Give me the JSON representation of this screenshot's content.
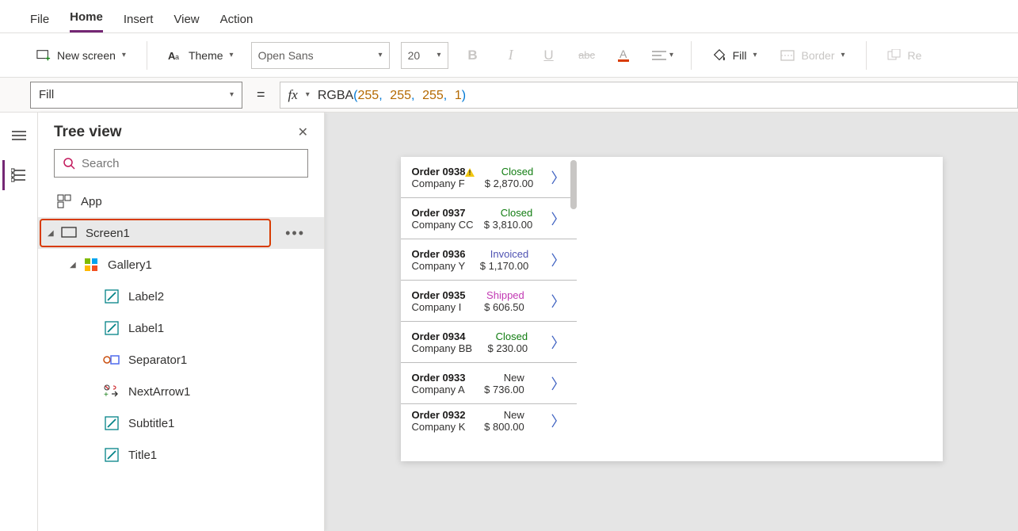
{
  "menubar": [
    "File",
    "Home",
    "Insert",
    "View",
    "Action"
  ],
  "active_tab": "Home",
  "ribbon": {
    "new_screen": "New screen",
    "theme": "Theme",
    "font_name": "Open Sans",
    "font_size": "20",
    "fill_label": "Fill",
    "border_label": "Border",
    "reorder_label": "Re"
  },
  "formula": {
    "property": "Fill",
    "fx": "fx",
    "expr_fn": "RGBA",
    "expr_args": [
      "255",
      "255",
      "255",
      "1"
    ]
  },
  "tree": {
    "title": "Tree view",
    "search_placeholder": "Search",
    "nodes": {
      "app": "App",
      "screen1": "Screen1",
      "gallery1": "Gallery1",
      "label2": "Label2",
      "label1": "Label1",
      "separator1": "Separator1",
      "nextarrow1": "NextArrow1",
      "subtitle1": "Subtitle1",
      "title1": "Title1"
    }
  },
  "gallery": [
    {
      "order": "Order 0938",
      "company": "Company F",
      "status": "Closed",
      "status_class": "st-closed",
      "amount": "$ 2,870.00",
      "warn": true
    },
    {
      "order": "Order 0937",
      "company": "Company CC",
      "status": "Closed",
      "status_class": "st-closed",
      "amount": "$ 3,810.00",
      "warn": false
    },
    {
      "order": "Order 0936",
      "company": "Company Y",
      "status": "Invoiced",
      "status_class": "st-invoiced",
      "amount": "$ 1,170.00",
      "warn": false
    },
    {
      "order": "Order 0935",
      "company": "Company I",
      "status": "Shipped",
      "status_class": "st-shipped",
      "amount": "$ 606.50",
      "warn": false
    },
    {
      "order": "Order 0934",
      "company": "Company BB",
      "status": "Closed",
      "status_class": "st-closed",
      "amount": "$ 230.00",
      "warn": false
    },
    {
      "order": "Order 0933",
      "company": "Company A",
      "status": "New",
      "status_class": "st-new",
      "amount": "$ 736.00",
      "warn": false
    },
    {
      "order": "Order 0932",
      "company": "Company K",
      "status": "New",
      "status_class": "st-new",
      "amount": "$ 800.00",
      "warn": false
    }
  ]
}
